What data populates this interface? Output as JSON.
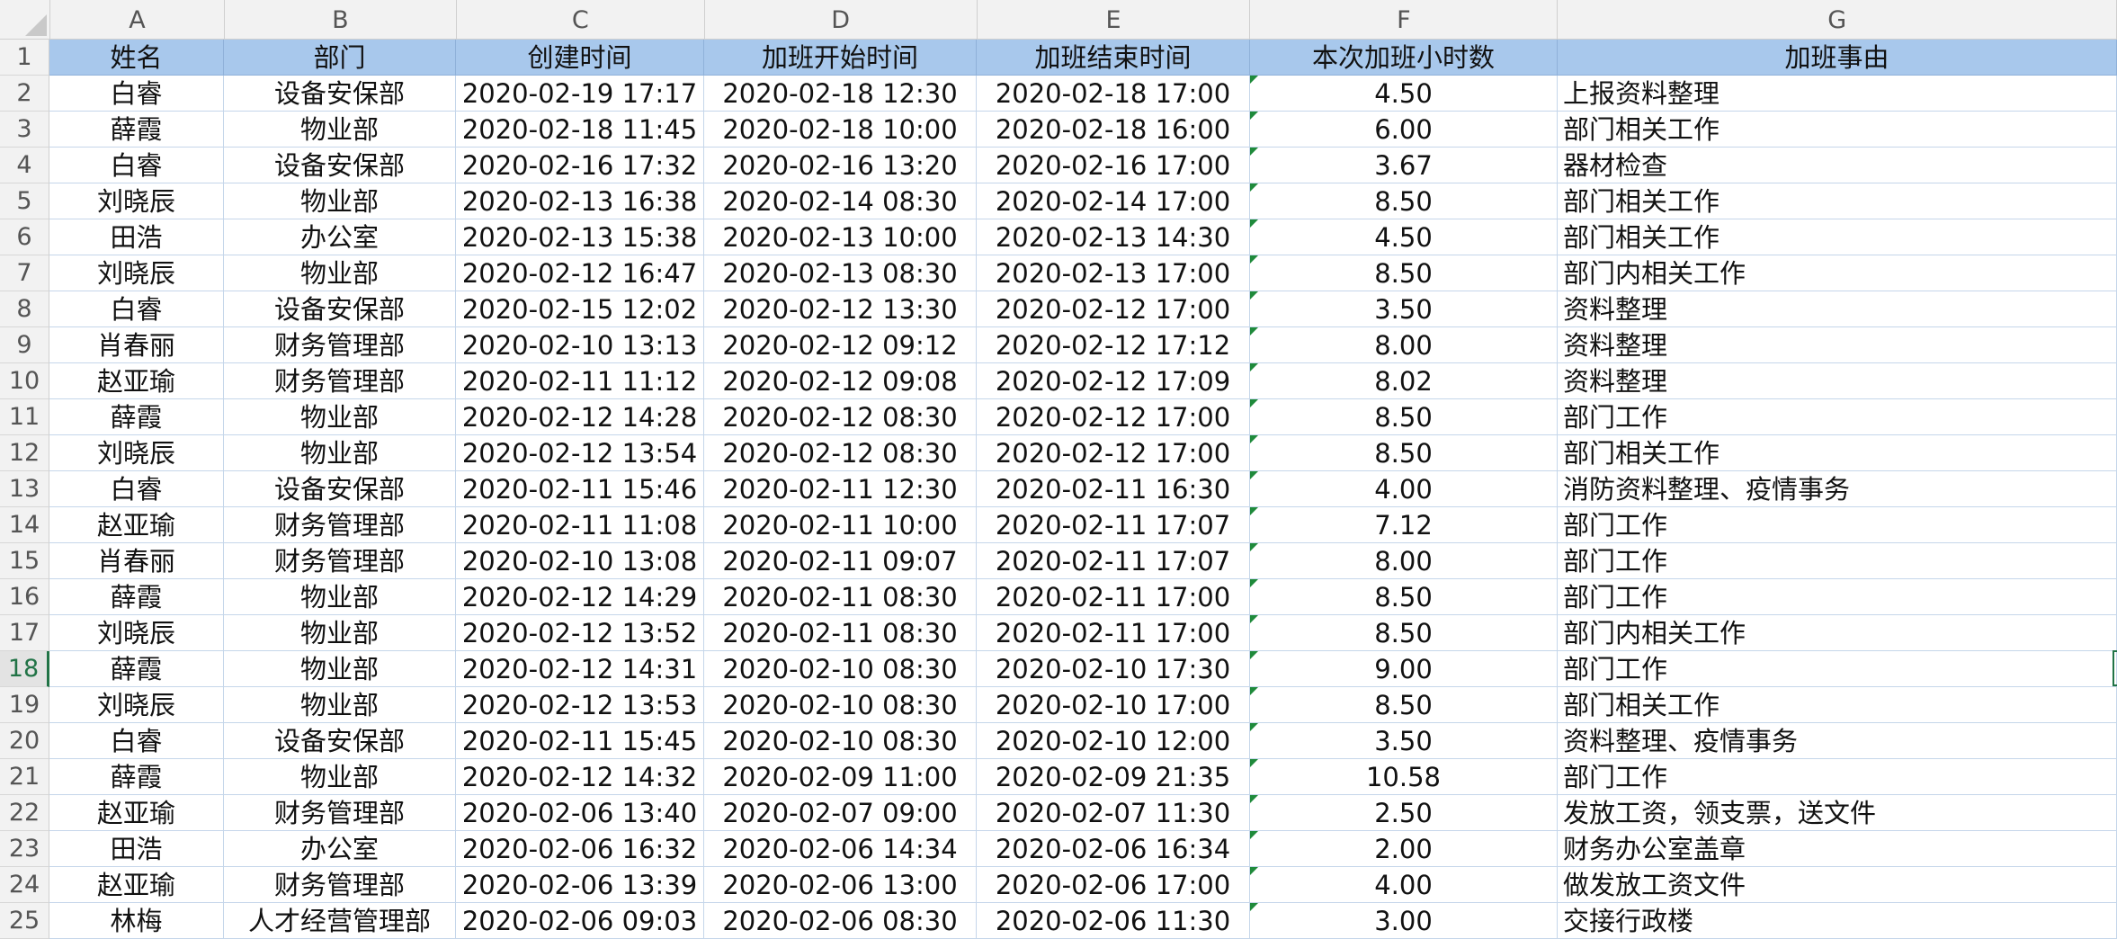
{
  "columns": [
    "A",
    "B",
    "C",
    "D",
    "E",
    "F",
    "G"
  ],
  "header": [
    "姓名",
    "部门",
    "创建时间",
    "加班开始时间",
    "加班结束时间",
    "本次加班小时数",
    "加班事由"
  ],
  "rows": [
    [
      "白睿",
      "设备安保部",
      "2020-02-19 17:17",
      "2020-02-18 12:30",
      "2020-02-18 17:00",
      "4.50",
      "上报资料整理"
    ],
    [
      "薛霞",
      "物业部",
      "2020-02-18 11:45",
      "2020-02-18 10:00",
      "2020-02-18 16:00",
      "6.00",
      "部门相关工作"
    ],
    [
      "白睿",
      "设备安保部",
      "2020-02-16 17:32",
      "2020-02-16 13:20",
      "2020-02-16 17:00",
      "3.67",
      "器材检查"
    ],
    [
      "刘晓辰",
      "物业部",
      "2020-02-13 16:38",
      "2020-02-14 08:30",
      "2020-02-14 17:00",
      "8.50",
      "部门相关工作"
    ],
    [
      "田浩",
      "办公室",
      "2020-02-13 15:38",
      "2020-02-13 10:00",
      "2020-02-13 14:30",
      "4.50",
      "部门相关工作"
    ],
    [
      "刘晓辰",
      "物业部",
      "2020-02-12 16:47",
      "2020-02-13 08:30",
      "2020-02-13 17:00",
      "8.50",
      "部门内相关工作"
    ],
    [
      "白睿",
      "设备安保部",
      "2020-02-15 12:02",
      "2020-02-12 13:30",
      "2020-02-12 17:00",
      "3.50",
      "资料整理"
    ],
    [
      "肖春丽",
      "财务管理部",
      "2020-02-10 13:13",
      "2020-02-12 09:12",
      "2020-02-12 17:12",
      "8.00",
      "资料整理"
    ],
    [
      "赵亚瑜",
      "财务管理部",
      "2020-02-11 11:12",
      "2020-02-12 09:08",
      "2020-02-12 17:09",
      "8.02",
      "资料整理"
    ],
    [
      "薛霞",
      "物业部",
      "2020-02-12 14:28",
      "2020-02-12 08:30",
      "2020-02-12 17:00",
      "8.50",
      "部门工作"
    ],
    [
      "刘晓辰",
      "物业部",
      "2020-02-12 13:54",
      "2020-02-12 08:30",
      "2020-02-12 17:00",
      "8.50",
      "部门相关工作"
    ],
    [
      "白睿",
      "设备安保部",
      "2020-02-11 15:46",
      "2020-02-11 12:30",
      "2020-02-11 16:30",
      "4.00",
      "消防资料整理、疫情事务"
    ],
    [
      "赵亚瑜",
      "财务管理部",
      "2020-02-11 11:08",
      "2020-02-11 10:00",
      "2020-02-11 17:07",
      "7.12",
      "部门工作"
    ],
    [
      "肖春丽",
      "财务管理部",
      "2020-02-10 13:08",
      "2020-02-11 09:07",
      "2020-02-11 17:07",
      "8.00",
      "部门工作"
    ],
    [
      "薛霞",
      "物业部",
      "2020-02-12 14:29",
      "2020-02-11 08:30",
      "2020-02-11 17:00",
      "8.50",
      "部门工作"
    ],
    [
      "刘晓辰",
      "物业部",
      "2020-02-12 13:52",
      "2020-02-11 08:30",
      "2020-02-11 17:00",
      "8.50",
      "部门内相关工作"
    ],
    [
      "薛霞",
      "物业部",
      "2020-02-12 14:31",
      "2020-02-10 08:30",
      "2020-02-10 17:30",
      "9.00",
      "部门工作"
    ],
    [
      "刘晓辰",
      "物业部",
      "2020-02-12 13:53",
      "2020-02-10 08:30",
      "2020-02-10 17:00",
      "8.50",
      "部门相关工作"
    ],
    [
      "白睿",
      "设备安保部",
      "2020-02-11 15:45",
      "2020-02-10 08:30",
      "2020-02-10 12:00",
      "3.50",
      "资料整理、疫情事务"
    ],
    [
      "薛霞",
      "物业部",
      "2020-02-12 14:32",
      "2020-02-09 11:00",
      "2020-02-09 21:35",
      "10.58",
      "部门工作"
    ],
    [
      "赵亚瑜",
      "财务管理部",
      "2020-02-06 13:40",
      "2020-02-07 09:00",
      "2020-02-07 11:30",
      "2.50",
      "发放工资，领支票，送文件"
    ],
    [
      "田浩",
      "办公室",
      "2020-02-06 16:32",
      "2020-02-06 14:34",
      "2020-02-06 16:34",
      "2.00",
      "财务办公室盖章"
    ],
    [
      "赵亚瑜",
      "财务管理部",
      "2020-02-06 13:39",
      "2020-02-06 13:00",
      "2020-02-06 17:00",
      "4.00",
      "做发放工资文件"
    ],
    [
      "林梅",
      "人才经营管理部",
      "2020-02-06 09:03",
      "2020-02-06 08:30",
      "2020-02-06 11:30",
      "3.00",
      "交接行政楼"
    ]
  ],
  "selected_row": 18,
  "colors": {
    "header_fill": "#a8c8ec",
    "grid": "#c5d6ea",
    "selection": "#217346",
    "error_marker": "#1f8a3b"
  }
}
